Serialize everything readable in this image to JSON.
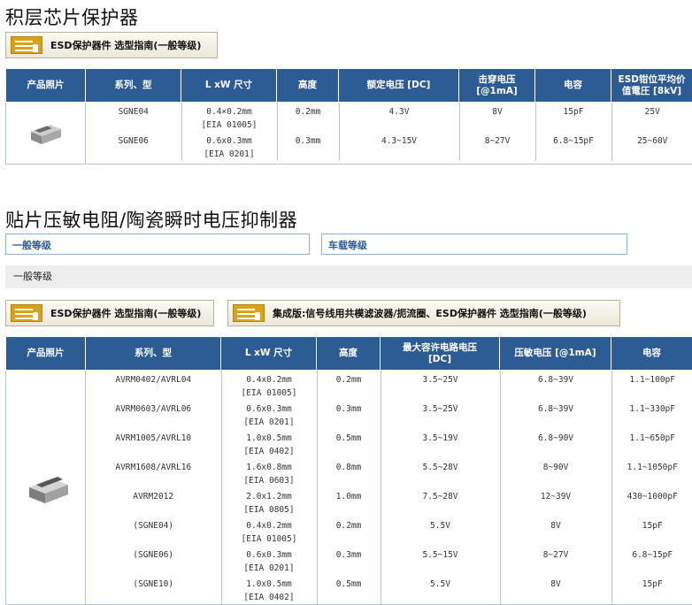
{
  "section1": {
    "title": "积层芯片保护器",
    "guide_label": "ESD保护器件 选型指南(一般等级)",
    "headers": [
      "产品照片",
      "系列、型",
      "L xW 尺寸",
      "高度",
      "额定电压 [DC]",
      "击穿电压\n[@1mA]",
      "电容",
      "ESD钳位平均价\n值電圧 [8kV]"
    ],
    "rows": [
      [
        "SGNE04",
        "0.4×0.2mm",
        "[EIA 01005]",
        "0.2mm",
        "4.3V",
        "8V",
        "15pF",
        "25V"
      ],
      [
        "SGNE06",
        "0.6x0.3mm",
        "[EIA 0201]",
        "0.3mm",
        "4.3~15V",
        "8~27V",
        "6.8~15pF",
        "25~60V"
      ]
    ]
  },
  "section2": {
    "title": "贴片压敏电阻/陶瓷瞬时电压抑制器",
    "tabs": [
      "一般等级",
      "车载等级"
    ],
    "bar_label": "一般等级",
    "guide_label_1": "ESD保护器件 选型指南(一般等级)",
    "guide_label_2": "集成版:信号线用共模滤波器/扼流圈、ESD保护器件 选型指南(一般等级)",
    "headers": [
      "产品照片",
      "系列、型",
      "L xW 尺寸",
      "高度",
      "最大容许电路电压\n[DC]",
      "压敏电压 [@1mA]",
      "电容"
    ],
    "rows": [
      [
        "AVRM0402/AVRL04",
        "0.4x0.2mm",
        "[EIA 01005]",
        "0.2mm",
        "3.5~25V",
        "6.8~39V",
        "1.1~100pF"
      ],
      [
        "AVRM0603/AVRL06",
        "0.6x0.3mm",
        "[EIA 0201]",
        "0.3mm",
        "3.5~25V",
        "6.8~39V",
        "1.1~330pF"
      ],
      [
        "AVRM1005/AVRL10",
        "1.0x0.5mm",
        "[EIA 0402]",
        "0.5mm",
        "3.5~19V",
        "6.8~90V",
        "1.1~650pF"
      ],
      [
        "AVRM1608/AVRL16",
        "1.6x0.8mm",
        "[EIA 0603]",
        "0.8mm",
        "5.5~28V",
        "8~90V",
        "1.1~1050pF"
      ],
      [
        "AVRM2012",
        "2.0x1.2mm",
        "[EIA 0805]",
        "1.0mm",
        "7.5~28V",
        "12~39V",
        "430~1000pF"
      ],
      [
        "(SGNE04)",
        "0.4x0.2mm",
        "[EIA 01005]",
        "0.2mm",
        "5.5V",
        "8V",
        "15pF"
      ],
      [
        "(SGNE06)",
        "0.6x0.3mm",
        "[EIA 0201]",
        "0.3mm",
        "5.5~15V",
        "8~27V",
        "6.8~15pF"
      ],
      [
        "(SGNE10)",
        "1.0x0.5mm",
        "[EIA 0402]",
        "0.5mm",
        "5.5V",
        "8V",
        "15pF"
      ]
    ]
  }
}
